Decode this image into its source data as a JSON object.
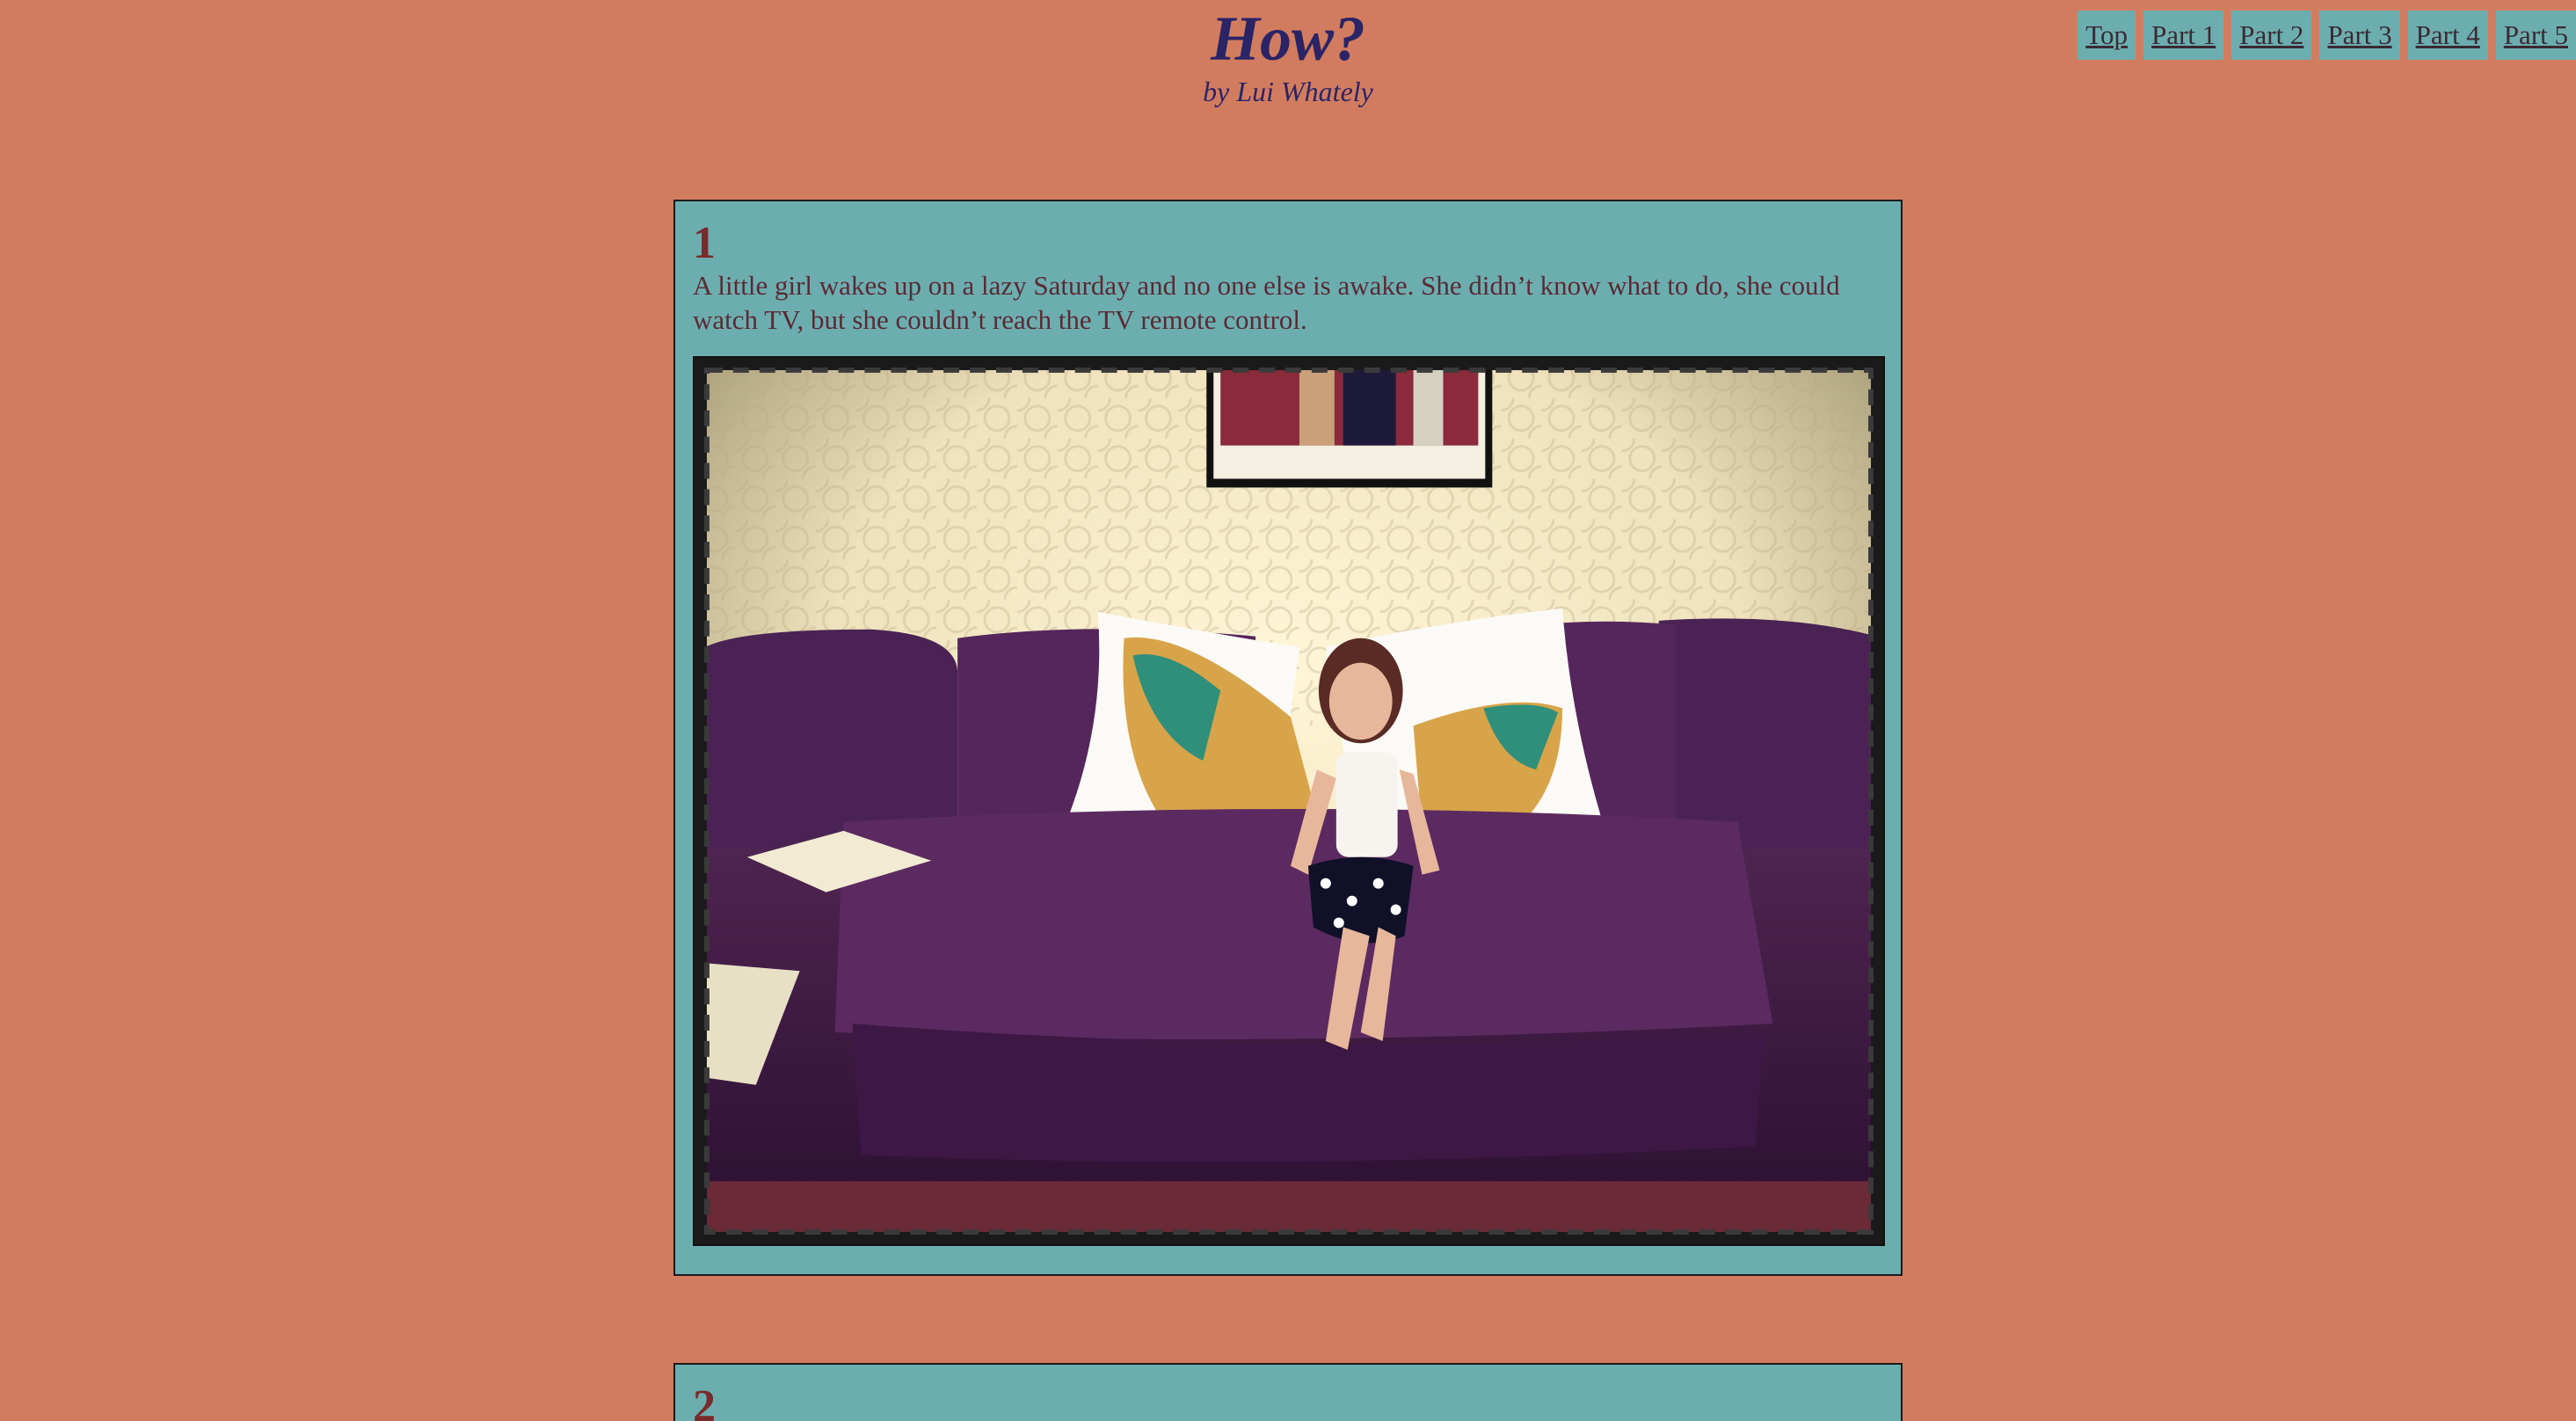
{
  "header": {
    "title": "How?",
    "byline": "by Lui Whately"
  },
  "nav": {
    "items": [
      "Top",
      "Part 1",
      "Part 2",
      "Part 3",
      "Part 4",
      "Part 5"
    ]
  },
  "panels": [
    {
      "heading": "1",
      "text": "A little girl wakes up on a lazy Saturday and no one else is awake. She didn’t know what to do, she could watch TV, but she couldn’t reach the TV remote control."
    },
    {
      "heading": "2"
    }
  ],
  "colors": {
    "page_bg": "#d27c5f",
    "panel_bg": "#6caeb0",
    "title": "#2a2466",
    "heading": "#7a2a2a",
    "body_text": "#5a2a33"
  }
}
